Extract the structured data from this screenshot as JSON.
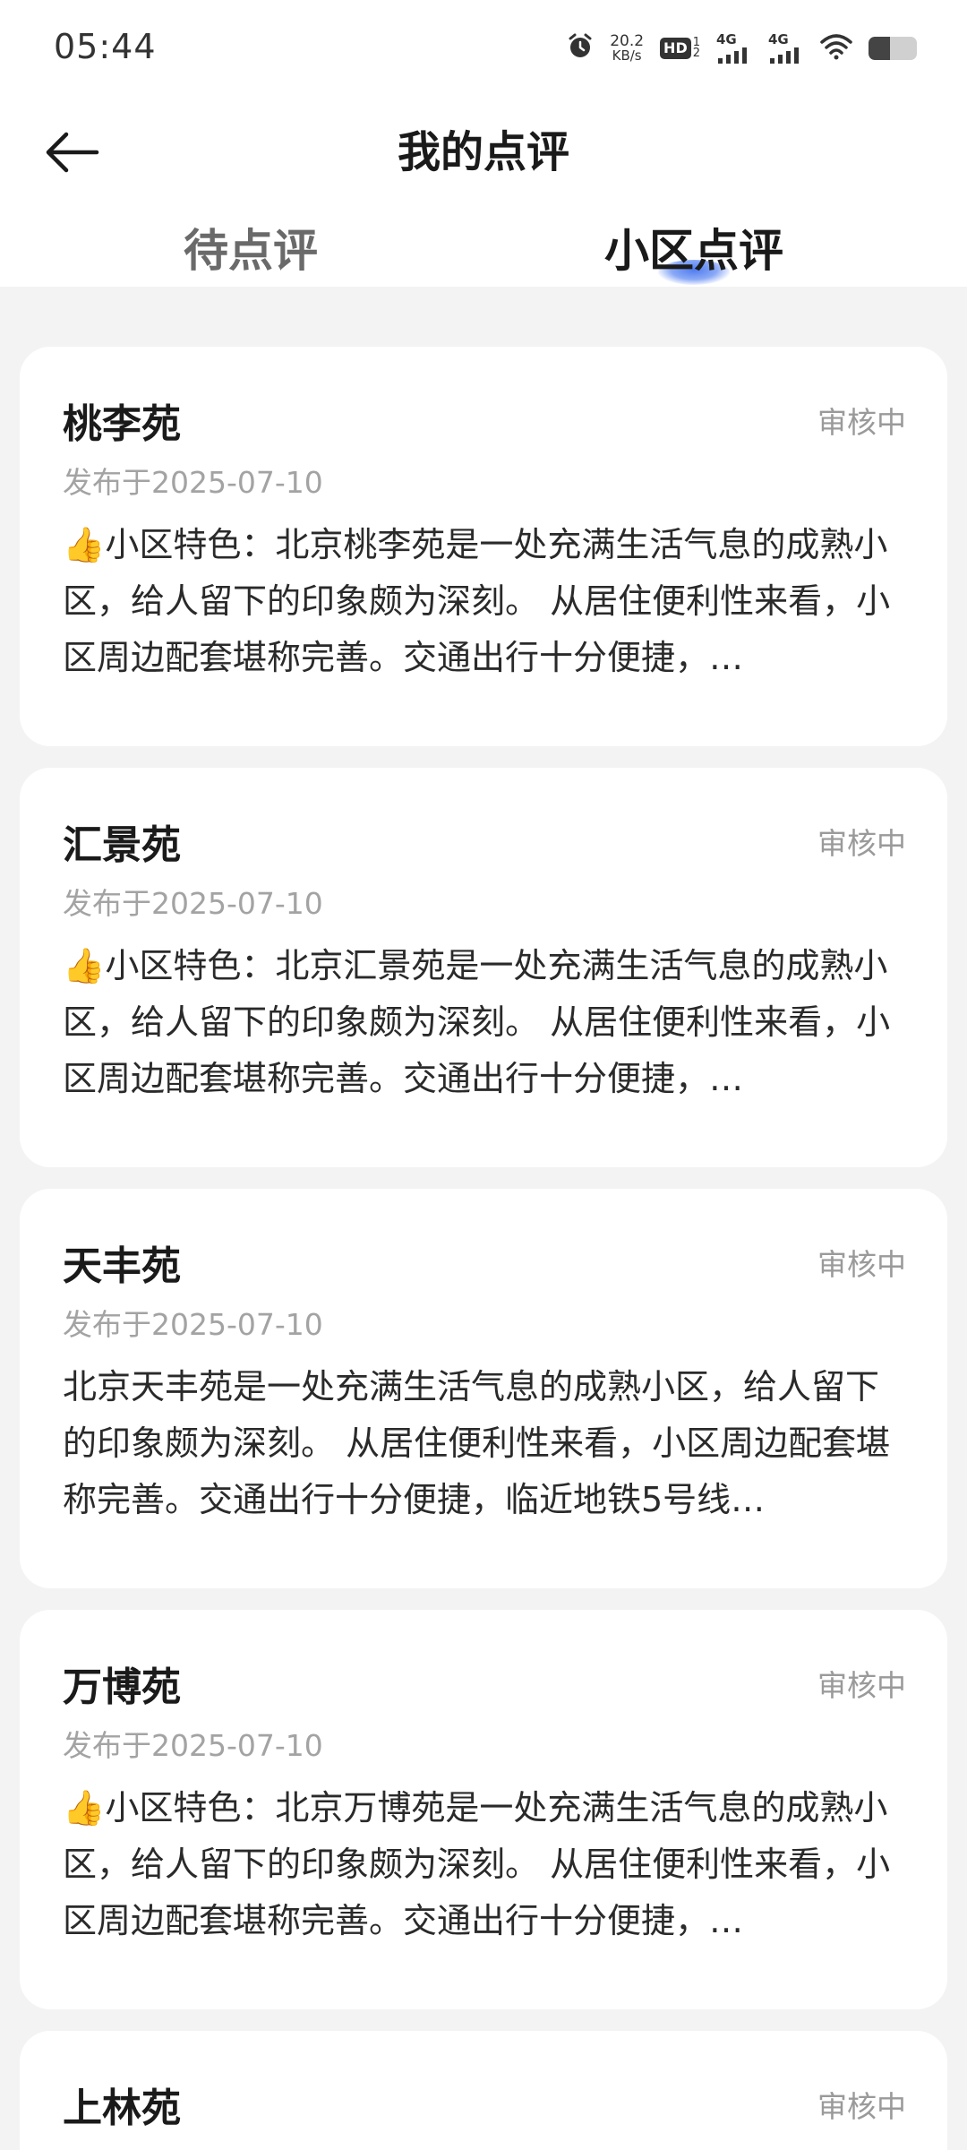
{
  "status_bar": {
    "time": "05:44",
    "net_speed_value": "20.2",
    "net_speed_unit": "KB/s",
    "hd_label": "HD",
    "hd_sub_top": "1",
    "hd_sub_bottom": "2",
    "signal1_label": "4G",
    "signal2_label": "4G",
    "battery_level": 0.45,
    "icons": [
      "alarm-icon",
      "hd-icon",
      "signal-icon",
      "signal-icon",
      "wifi-icon",
      "battery-icon"
    ]
  },
  "header": {
    "title": "我的点评",
    "back_icon": "back-arrow-icon"
  },
  "tabs": [
    {
      "label": "待点评",
      "active": false
    },
    {
      "label": "小区点评",
      "active": true
    }
  ],
  "accent_color": "#4f7cf0",
  "reviews": [
    {
      "name": "桃李苑",
      "status": "审核中",
      "date": "发布于2025-07-10",
      "has_thumb": true,
      "thumb": "👍",
      "text": "小区特色：北京桃李苑是一处充满生活气息的成熟小区，给人留下的印象颇为深刻。 从居住便利性来看，小区周边配套堪称完善。交通出行十分便捷，…"
    },
    {
      "name": "汇景苑",
      "status": "审核中",
      "date": "发布于2025-07-10",
      "has_thumb": true,
      "thumb": "👍",
      "text": "小区特色：北京汇景苑是一处充满生活气息的成熟小区，给人留下的印象颇为深刻。 从居住便利性来看，小区周边配套堪称完善。交通出行十分便捷，…"
    },
    {
      "name": "天丰苑",
      "status": "审核中",
      "date": "发布于2025-07-10",
      "has_thumb": false,
      "thumb": "",
      "text": "北京天丰苑是一处充满生活气息的成熟小区，给人留下的印象颇为深刻。 从居住便利性来看，小区周边配套堪称完善。交通出行十分便捷，临近地铁5号线…"
    },
    {
      "name": "万博苑",
      "status": "审核中",
      "date": "发布于2025-07-10",
      "has_thumb": true,
      "thumb": "👍",
      "text": "小区特色：北京万博苑是一处充满生活气息的成熟小区，给人留下的印象颇为深刻。 从居住便利性来看，小区周边配套堪称完善。交通出行十分便捷，…"
    },
    {
      "name": "上林苑",
      "status": "审核中",
      "date": "",
      "has_thumb": false,
      "thumb": "",
      "text": ""
    }
  ]
}
